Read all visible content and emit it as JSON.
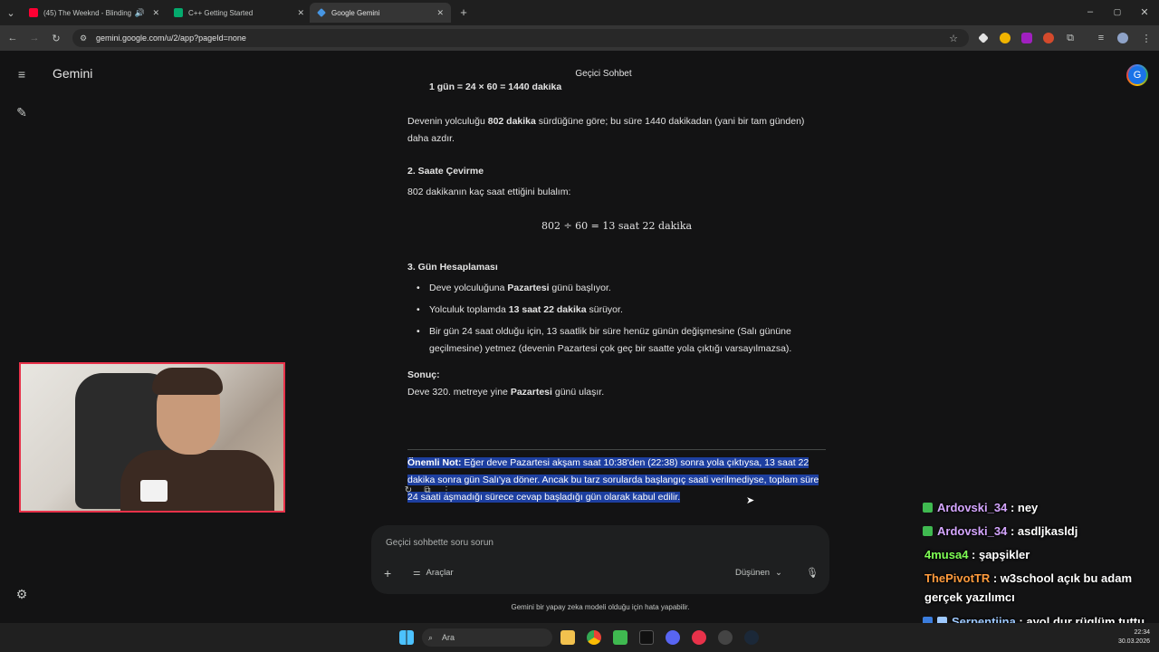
{
  "browser": {
    "tabs": [
      {
        "title": "(45) The Weeknd - Blinding",
        "icon": "youtube-icon",
        "color": "#ff0033"
      },
      {
        "title": "C++ Getting Started",
        "icon": "w3schools-icon",
        "color": "#04aa6d"
      },
      {
        "title": "Google Gemini",
        "icon": "gemini-icon",
        "color": "#4796e3",
        "active": true
      }
    ],
    "url": "gemini.google.com/u/2/app?pageId=none"
  },
  "gemini": {
    "brand": "Gemini",
    "conversation_title": "Geçici Sohbet",
    "avatar_letter": "G",
    "response": {
      "top_fragment": "1 gün = 24 × 60 = 1440 dakika",
      "para1_a": "Devenin yolculuğu ",
      "para1_b": "802 dakika",
      "para1_c": " sürdüğüne göre; bu süre 1440 dakikadan (yani bir tam günden) daha azdır.",
      "h2": "2. Saate Çevirme",
      "para2": "802 dakikanın kaç saat ettiğini bulalım:",
      "formula": "802 ÷ 60 = 13 saat 22 dakika",
      "h3": "3. Gün Hesaplaması",
      "b1_a": "Deve yolculuğuna ",
      "b1_b": "Pazartesi",
      "b1_c": " günü başlıyor.",
      "b2_a": "Yolculuk toplamda ",
      "b2_b": "13 saat 22 dakika",
      "b2_c": " sürüyor.",
      "b3": "Bir gün 24 saat olduğu için, 13 saatlik bir süre henüz günün değişmesine (Salı gününe geçilmesine) yetmez (devenin Pazartesi çok geç bir saatte yola çıktığı varsayılmazsa).",
      "result_head": "Sonuç:",
      "result_a": "Deve 320. metreye yine ",
      "result_b": "Pazartesi",
      "result_c": " günü ulaşır.",
      "note_label": "Önemli Not:",
      "note_text": " Eğer deve Pazartesi akşam saat 10:38'den (22:38) sonra yola çıktıysa, 13 saat 22 dakika sonra gün Salı'ya döner. Ancak bu tarz sorularda başlangıç saati verilmediyse, toplam süre 24 saati aşmadığı sürece cevap başladığı gün olarak kabul edilir."
    },
    "input": {
      "placeholder": "Geçici sohbette soru sorun",
      "tools_label": "Araçlar",
      "model_label": "Düşünen"
    },
    "disclaimer": "Gemini bir yapay zeka modeli olduğu için hata yapabilir."
  },
  "chat": [
    {
      "user": "Ardovski_34",
      "message": " : ney",
      "color": "#d5a6ff"
    },
    {
      "user": "Ardovski_34",
      "message": " : asdljkasldj",
      "color": "#d5a6ff"
    },
    {
      "user": "4musa4",
      "message": " : şapşikler",
      "color": "#7fff55"
    },
    {
      "user": "ThePivotTR",
      "message": " : w3school açık bu adam gerçek yazılımcı",
      "color": "#ff9b3d"
    },
    {
      "user": "Serpentiina",
      "message": " : ayol dur rüglüm tuttu her yer şey oldu",
      "color": "#9ec9ff"
    }
  ],
  "taskbar": {
    "search_placeholder": "Ara",
    "time": "22:34",
    "date": "30.03.2026"
  }
}
